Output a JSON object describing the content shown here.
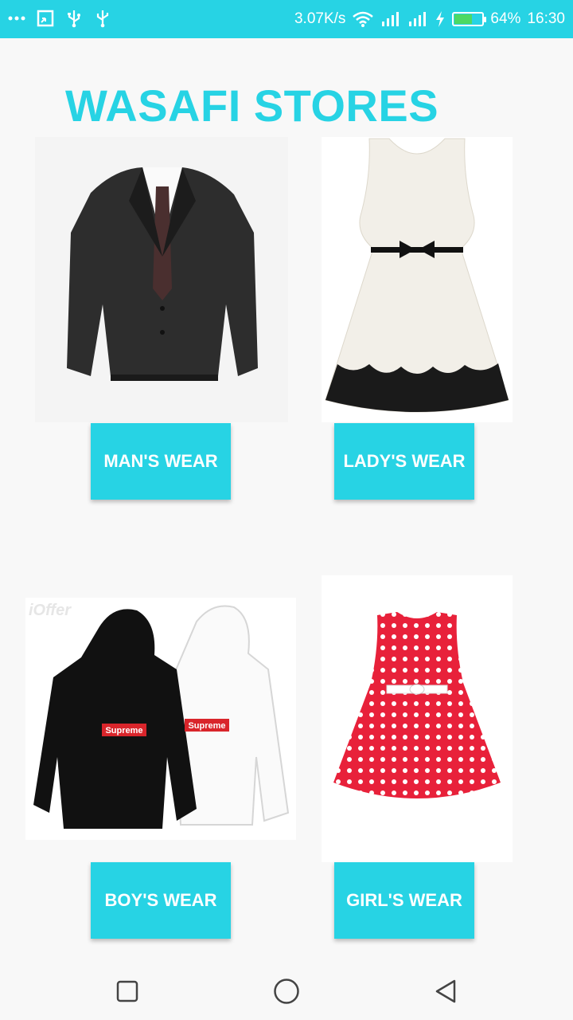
{
  "status_bar": {
    "net_speed": "3.07K/s",
    "battery_percent_label": "64%",
    "battery_level": 0.64,
    "time": "16:30"
  },
  "app": {
    "title": "WASAFI STORES",
    "accent_color": "#27d3e4"
  },
  "categories": [
    {
      "label": "MAN'S WEAR",
      "image": "mens-suit-image"
    },
    {
      "label": "LADY'S WEAR",
      "image": "white-dress-image"
    },
    {
      "label": "BOY'S WEAR",
      "image": "hoodies-image",
      "watermark": "iOffer"
    },
    {
      "label": "GIRL'S WEAR",
      "image": "polka-dot-dress-image"
    }
  ],
  "hoodie_patch_text": "Supreme",
  "nav": {
    "icons": [
      "recent-apps-icon",
      "home-icon",
      "back-icon"
    ]
  }
}
